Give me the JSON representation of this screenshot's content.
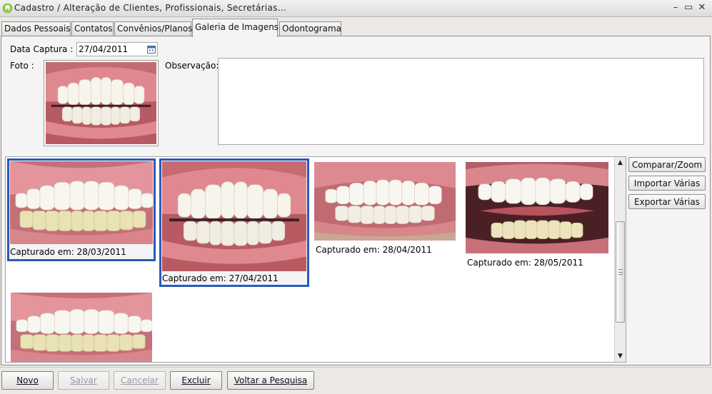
{
  "window": {
    "title": "Cadastro / Alteração de Clientes, Profissionais, Secretárias...",
    "controls": {
      "minimize": "–",
      "maximize": "▭",
      "close": "✕"
    }
  },
  "tabs": [
    {
      "label": "Dados Pessoais",
      "active": false
    },
    {
      "label": "Contatos",
      "active": false
    },
    {
      "label": "Convênios/Planos",
      "active": false
    },
    {
      "label": "Galeria de Imagens",
      "active": true
    },
    {
      "label": "Odontograma",
      "active": false
    }
  ],
  "form": {
    "date_label": "Data Captura :",
    "date_value": "27/04/2011",
    "photo_label": "Foto :",
    "obs_label": "Observação:",
    "obs_value": ""
  },
  "gallery": {
    "items": [
      {
        "caption": "Capturado em:  28/03/2011",
        "selected": true
      },
      {
        "caption": "Capturado em:  27/04/2011",
        "selected": true
      },
      {
        "caption": "Capturado em:  28/04/2011",
        "selected": false
      },
      {
        "caption": "Capturado em:  28/05/2011",
        "selected": false
      },
      {
        "caption": "",
        "selected": false
      }
    ],
    "scroll_up_icon": "▲",
    "scroll_down_icon": "▼"
  },
  "side_buttons": {
    "compare": "Comparar/Zoom",
    "import": "Importar Várias",
    "export": "Exportar Várias"
  },
  "bottom_buttons": {
    "new": "Novo",
    "save": "Salvar",
    "cancel": "Cancelar",
    "delete": "Excluir",
    "back": "Voltar a Pesquisa"
  },
  "colors": {
    "selection_border": "#2a5ab8",
    "gum": "#d77a82",
    "lip": "#b95c64",
    "tooth": "#f7f4ec"
  }
}
